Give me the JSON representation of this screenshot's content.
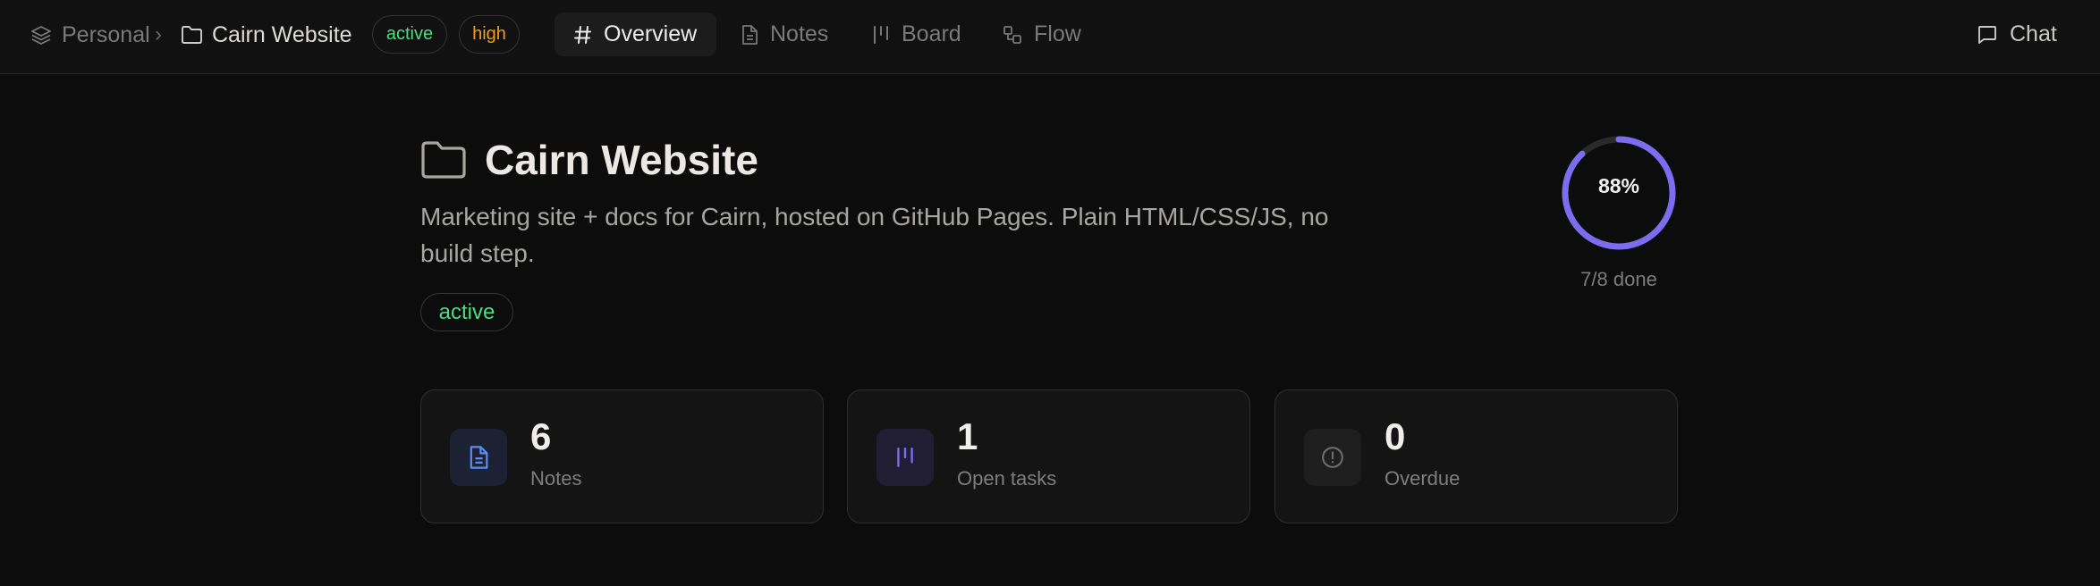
{
  "breadcrumb": {
    "workspace": "Personal",
    "separator": "›",
    "project": "Cairn Website"
  },
  "header_badges": {
    "status": "active",
    "priority": "high"
  },
  "tabs": [
    {
      "label": "Overview",
      "icon": "hash-icon",
      "active": true
    },
    {
      "label": "Notes",
      "icon": "document-icon",
      "active": false
    },
    {
      "label": "Board",
      "icon": "board-icon",
      "active": false
    },
    {
      "label": "Flow",
      "icon": "flow-icon",
      "active": false
    }
  ],
  "chat_label": "Chat",
  "project": {
    "title": "Cairn Website",
    "description": "Marketing site + docs for Cairn, hosted on GitHub Pages. Plain HTML/CSS/JS, no build step.",
    "status": "active"
  },
  "progress": {
    "percent_label": "88%",
    "fraction": 0.88,
    "done_label": "7/8 done"
  },
  "stats": [
    {
      "value": "6",
      "label": "Notes",
      "icon": "document-icon"
    },
    {
      "value": "1",
      "label": "Open tasks",
      "icon": "board-icon"
    },
    {
      "value": "0",
      "label": "Overdue",
      "icon": "alert-circle-icon"
    }
  ],
  "colors": {
    "accent": "#7c6cf0",
    "active_green": "#4ade80",
    "priority_orange": "#f59e0b",
    "notes_blue": "#5b8def"
  }
}
